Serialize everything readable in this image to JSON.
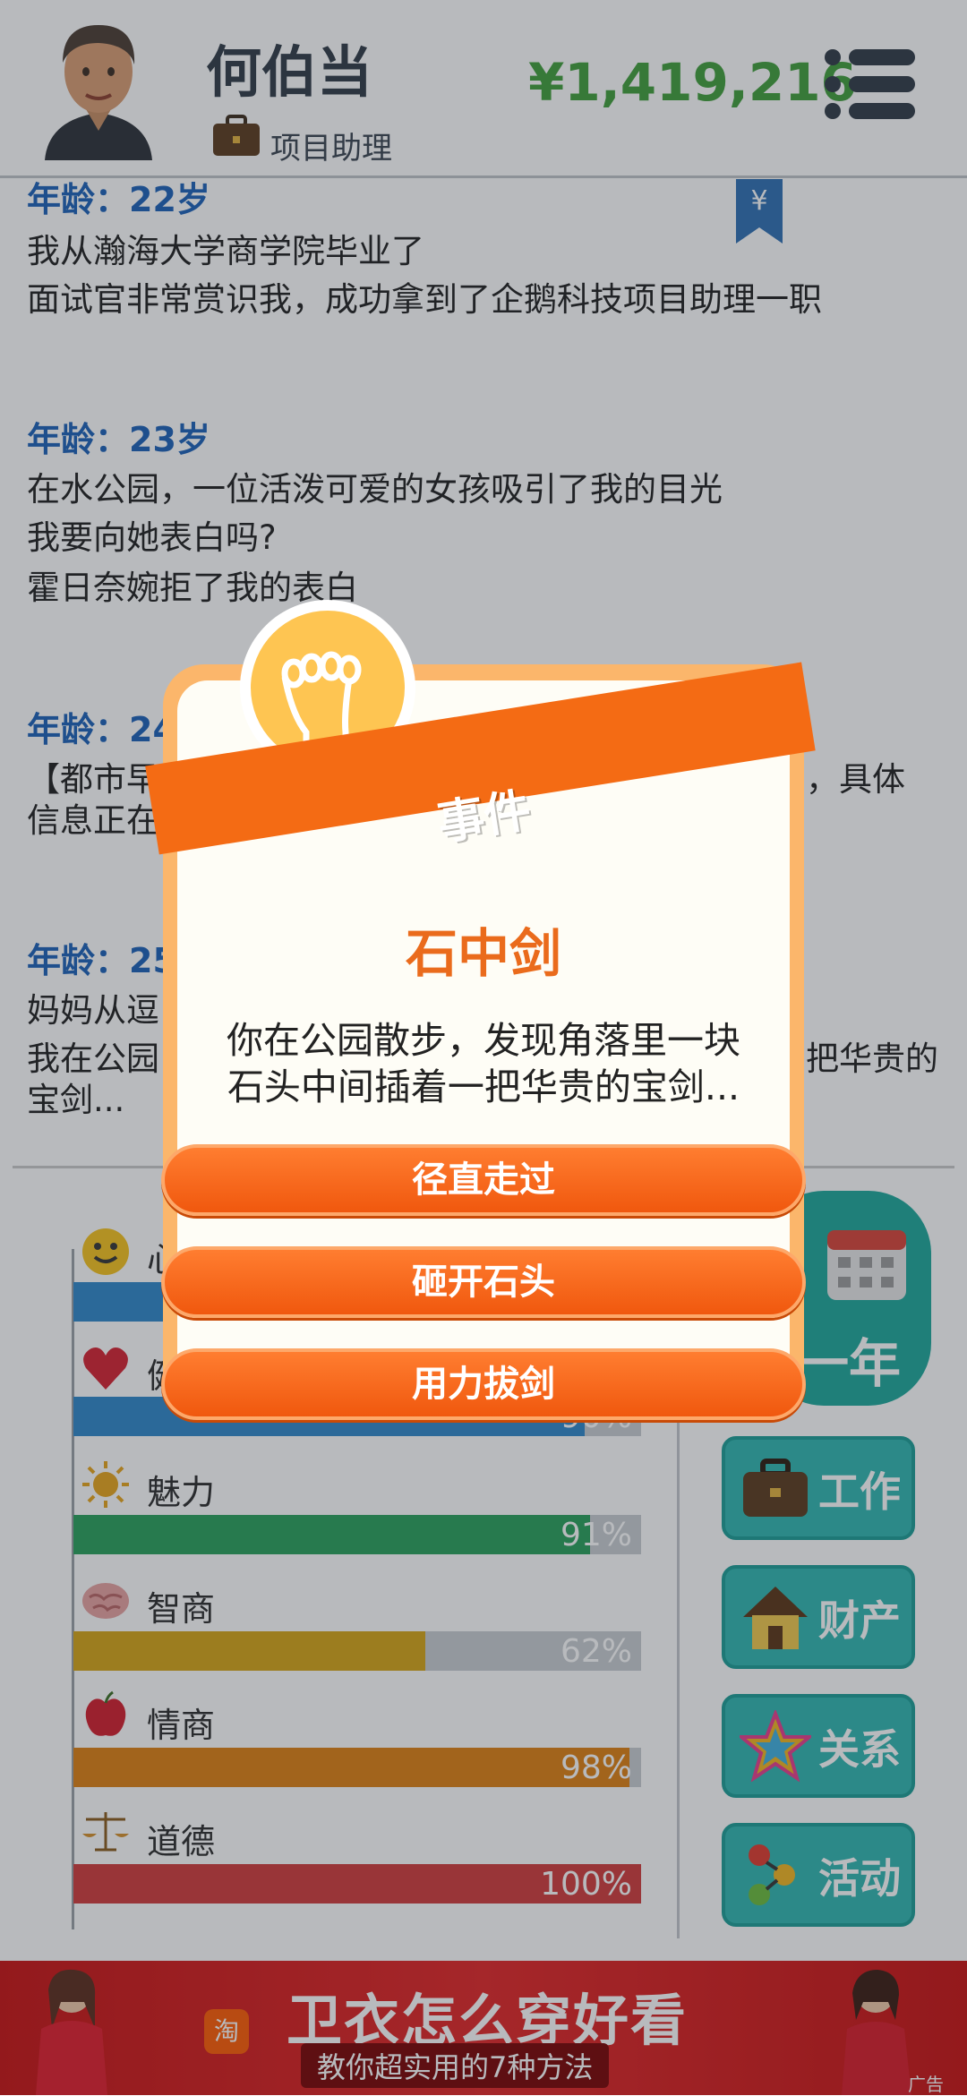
{
  "header": {
    "player_name": "何伯当",
    "job_title": "项目助理",
    "money": "¥1,419,216"
  },
  "log": [
    {
      "age": "年龄：22岁",
      "lines": [
        "我从瀚海大学商学院毕业了",
        "面试官非常赏识我，成功拿到了企鹅科技项目助理一职"
      ]
    },
    {
      "age": "年龄：23岁",
      "lines": [
        "在水公园，一位活泼可爱的女孩吸引了我的目光",
        "我要向她表白吗?",
        "霍日奈婉拒了我的表白"
      ]
    },
    {
      "age": "年龄：24",
      "lines": [
        "【都市早",
        "信息正在",
        "，具体"
      ]
    },
    {
      "age": "年龄：25",
      "lines": [
        "妈妈从逗",
        "我在公园",
        "宝剑...",
        "把华贵的"
      ]
    }
  ],
  "stats": [
    {
      "name": "心",
      "percent": "",
      "fill": 0.74,
      "color": "#2e86c9"
    },
    {
      "name": "健",
      "percent": "90%",
      "fill": 0.9,
      "color": "#2e86c9"
    },
    {
      "name": "魅力",
      "percent": "91%",
      "fill": 0.91,
      "color": "#27a05a"
    },
    {
      "name": "智商",
      "percent": "62%",
      "fill": 0.62,
      "color": "#d6a514"
    },
    {
      "name": "情商",
      "percent": "98%",
      "fill": 0.98,
      "color": "#de7f10"
    },
    {
      "name": "道德",
      "percent": "100%",
      "fill": 1.0,
      "color": "#d13a3a"
    }
  ],
  "side_buttons": {
    "next_year": "一年",
    "work": "工作",
    "assets": "财产",
    "relations": "关系",
    "activities": "活动"
  },
  "dialog": {
    "title": "事件",
    "event_name": "石中剑",
    "text_line1": "你在公园散步，发现角落里一块",
    "text_line2": "石头中间插着一把华贵的宝剑...",
    "choices": [
      "径直走过",
      "砸开石头",
      "用力拔剑"
    ]
  },
  "ad": {
    "title": "卫衣怎么穿好看",
    "subtitle": "教你超实用的7种方法",
    "tag": "广告",
    "logo": "淘"
  },
  "colors": {
    "money": "#3f9e3a",
    "age": "#1a60b8",
    "dialog_accent": "#f46b14",
    "side_button": "#2fb7b0"
  }
}
